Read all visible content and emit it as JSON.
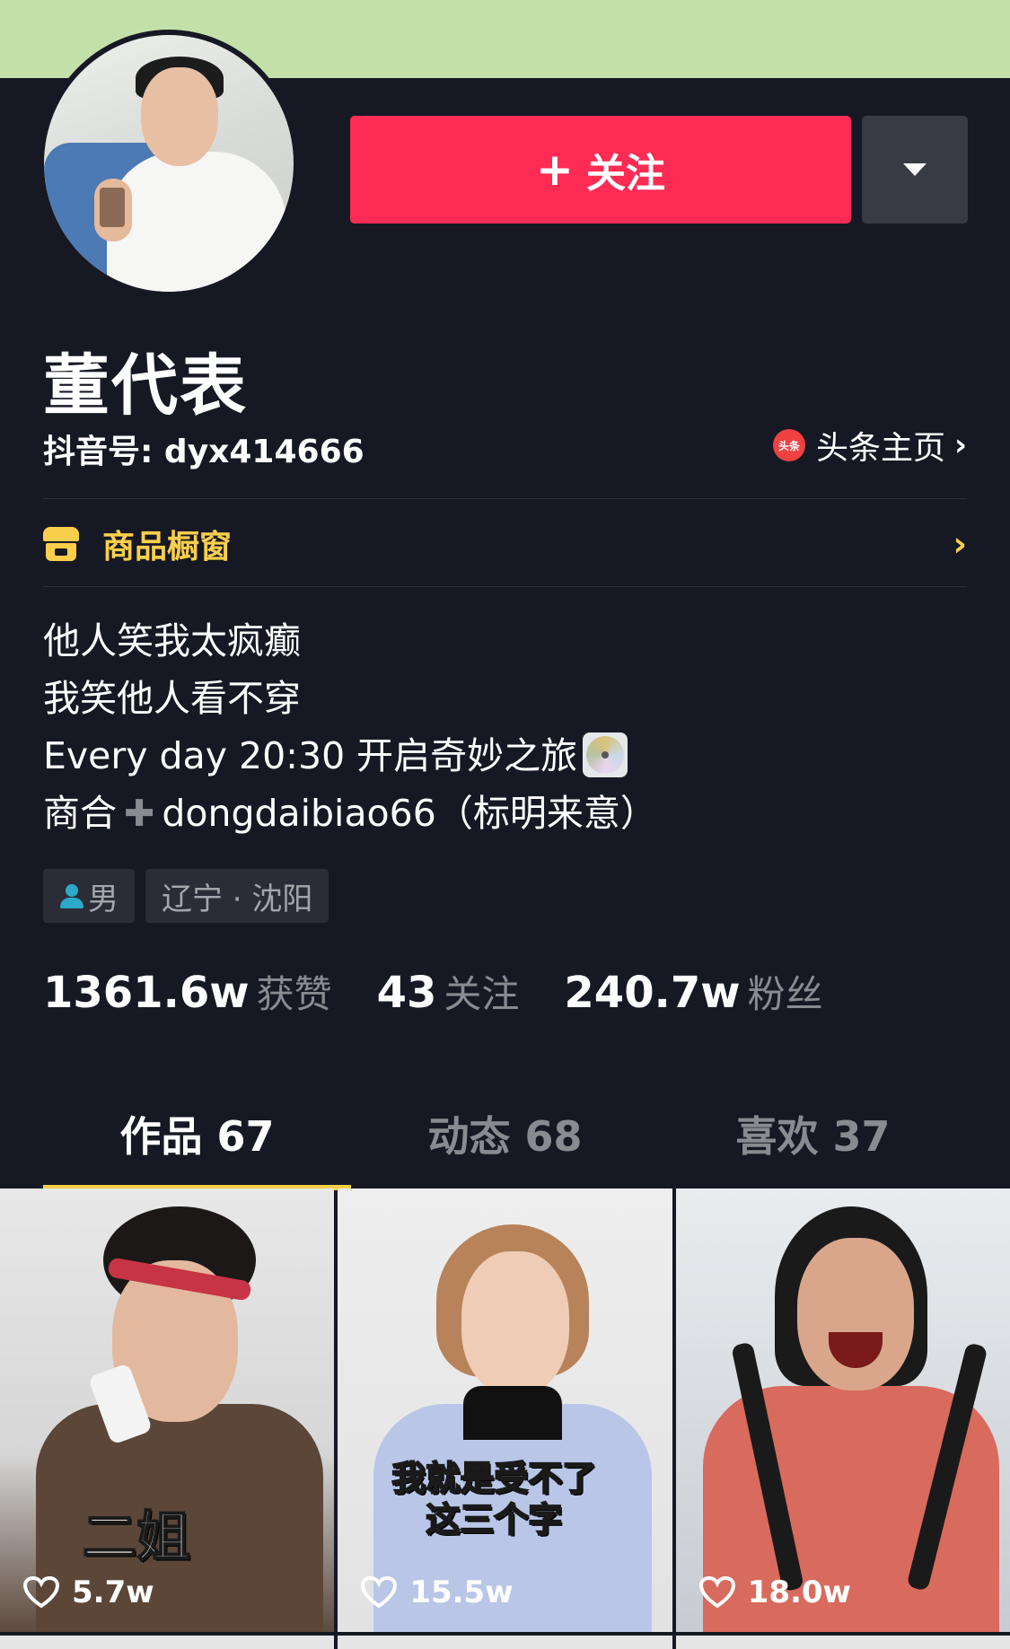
{
  "profile": {
    "name": "董代表",
    "douyin_id": "抖音号: dyx414666",
    "toutiao_badge": "头条",
    "toutiao_label": "头条主页",
    "follow_label": "关注",
    "shop_label": "商品橱窗",
    "bio_lines": [
      "他人笑我太疯癫",
      "我笑他人看不穿",
      "Every day 20:30 开启奇妙之旅",
      "商合",
      "dongdaibiao66（标明来意）"
    ],
    "tags": {
      "gender": "男",
      "location": "辽宁 · 沈阳"
    }
  },
  "stats": [
    {
      "value": "1361.6w",
      "label": "获赞"
    },
    {
      "value": "43",
      "label": "关注"
    },
    {
      "value": "240.7w",
      "label": "粉丝"
    }
  ],
  "tabs": [
    {
      "label": "作品 67",
      "active": true
    },
    {
      "label": "动态 68",
      "active": false
    },
    {
      "label": "喜欢 37",
      "active": false
    }
  ],
  "videos": [
    {
      "caption": "二姐",
      "likes": "5.7w"
    },
    {
      "caption_line1": "我就是受不了",
      "caption_line2": "这三个字",
      "likes": "15.5w"
    },
    {
      "likes": "18.0w"
    }
  ],
  "colors": {
    "background": "#161823",
    "accent": "#fe2c55",
    "highlight": "#facf4b",
    "cover": "#c3e0a9"
  },
  "icons": [
    "plus-icon",
    "dropdown-triangle-icon",
    "toutiao-logo-icon",
    "chevron-right-icon",
    "shop-icon",
    "disc-emoji-icon",
    "plus-emoji-icon",
    "person-icon",
    "heart-icon"
  ]
}
